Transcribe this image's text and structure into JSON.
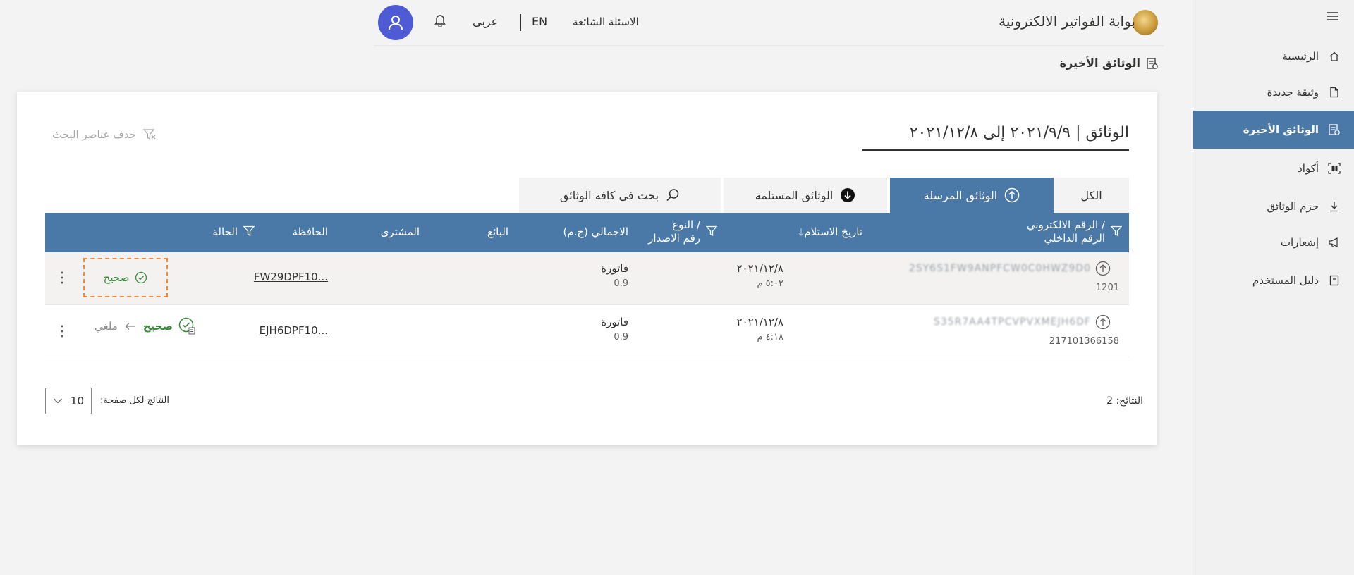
{
  "header": {
    "portal_title": "بوابة الفواتير الالكترونية",
    "faq": "الاسئلة الشائعة",
    "lang_en": "EN",
    "lang_ar": "عربى"
  },
  "page_title": "الوثائق الأخيرة",
  "sidebar": {
    "items": [
      {
        "label": "الرئيسية",
        "icon": "home-icon"
      },
      {
        "label": "وثيقة جديدة",
        "icon": "new-document-icon"
      },
      {
        "label": "الوثائق الأخيرة",
        "icon": "recent-documents-icon"
      },
      {
        "label": "أكواد",
        "icon": "barcode-icon"
      },
      {
        "label": "حزم الوثائق",
        "icon": "download-icon"
      },
      {
        "label": "إشعارات",
        "icon": "megaphone-icon"
      },
      {
        "label": "دليل المستخدم",
        "icon": "book-icon"
      }
    ],
    "active_index": 2
  },
  "filter": {
    "title": "الوثائق | ٢٠٢١/٩/٩ إلى ٢٠٢١/١٢/٨",
    "clear": "حذف عناصر البحث"
  },
  "tabs": [
    {
      "label": "الكل"
    },
    {
      "label": "الوثائق المرسلة"
    },
    {
      "label": "الوثائق المستلمة"
    },
    {
      "label": "بحث في كافة الوثائق"
    }
  ],
  "active_tab": 1,
  "table": {
    "headers": {
      "uuid_line1": "الرقم الالكتروني /",
      "uuid_line2": "الرقم الداخلي",
      "received": "تاريخ الاستلام",
      "type_line1": "النوع /",
      "type_line2": "رقم الاصدار",
      "total": "الاجمالي (ج.م)",
      "seller": "البائع",
      "buyer": "المشترى",
      "submission": "الحافظة",
      "status": "الحالة"
    },
    "rows": [
      {
        "uuid": "2SY6S1FW9ANPFCW0C0HWZ9D0",
        "internal_id": "1201",
        "date": "٢٠٢١/١٢/٨",
        "time": "٥:٠٢ م",
        "type": "فاتورة",
        "version": "0.9",
        "submission": "FW29DPF10...",
        "status": "صحيح",
        "previous_status": ""
      },
      {
        "uuid": "S35R7AA4TPCVPVXMEJH6DF",
        "internal_id": "217101366158",
        "date": "٢٠٢١/١٢/٨",
        "time": "٤:١٨ م",
        "type": "فاتورة",
        "version": "0.9",
        "submission": "EJH6DPF10...",
        "status": "صحيح",
        "previous_status": "ملغي"
      }
    ]
  },
  "footer": {
    "results": "النتائج: 2",
    "per_page_label": "النتائج لكل صفحة:",
    "per_page_value": "10"
  },
  "colors": {
    "primary": "#4a79a8",
    "avatar": "#4f5bd5",
    "valid": "#3a8a3a",
    "selection_outline": "#f0883a"
  }
}
